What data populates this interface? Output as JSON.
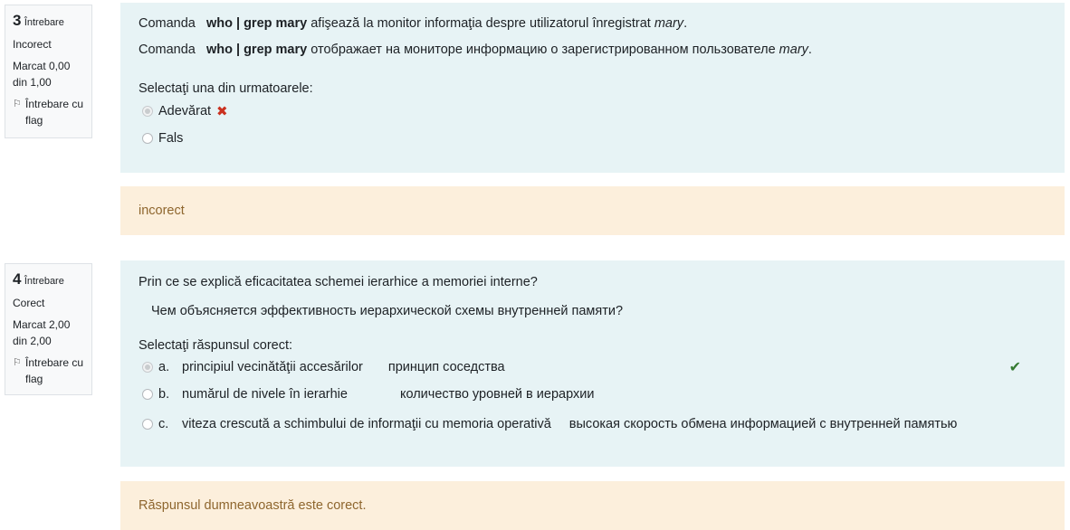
{
  "q3": {
    "number": "3",
    "word": "Întrebare",
    "state": "Incorect",
    "grade": "Marcat 0,00 din 1,00",
    "flag_label": "Întrebare cu flag",
    "text_ro_pre": "Comanda",
    "text_ro_cmd": "who | grep  mary",
    "text_ro_post": " afişează la monitor informaţia despre utilizatorul înregistrat ",
    "text_ro_user": "mary",
    "text_ro_end": ".",
    "text_ru_pre": "Comanda",
    "text_ru_cmd": "who | grep  mary",
    "text_ru_post": " отображает на мониторе информацию о зарегистрированном пользователе ",
    "text_ru_user": "mary",
    "text_ru_end": ".",
    "prompt": "Selectaţi una din urmatoarele:",
    "options": [
      {
        "label": "Adevărat",
        "selected": true,
        "mark": "✖"
      },
      {
        "label": "Fals",
        "selected": false
      }
    ],
    "feedback": "incorect"
  },
  "q4": {
    "number": "4",
    "word": "Întrebare",
    "state": "Corect",
    "grade": "Marcat 2,00 din 2,00",
    "flag_label": "Întrebare cu flag",
    "text_ro": "Prin ce se explică eficacitatea schemei ierarhice a memoriei interne?",
    "text_ru": "Чем объясняется эффективность иерархической схемы внутренней памяти?",
    "prompt": "Selectaţi răspunsul corect:",
    "options": [
      {
        "letter": "a.",
        "ro": "principiul vecinătăţii accesărilor",
        "ru": "принцип соседства",
        "selected": true,
        "mark": "✔"
      },
      {
        "letter": "b.",
        "ro": "numărul de nivele în ierarhie",
        "ru": "количество уровней в иерархии",
        "selected": false
      },
      {
        "letter": "c.",
        "ro": "viteza crescută a schimbului de informaţii cu memoria operativă",
        "ru": "высокая скорость обмена информацией с внутренней памятью",
        "selected": false
      }
    ],
    "feedback": "Răspunsul dumneavoastră este corect."
  },
  "icons": {
    "flag": "flag-icon",
    "cross": "cross-icon",
    "tick": "check-icon"
  },
  "colors": {
    "content_bg": "#e7f3f5",
    "feedback_bg": "#fcefdc",
    "incorrect": "#ca3120",
    "correct": "#357a32"
  }
}
